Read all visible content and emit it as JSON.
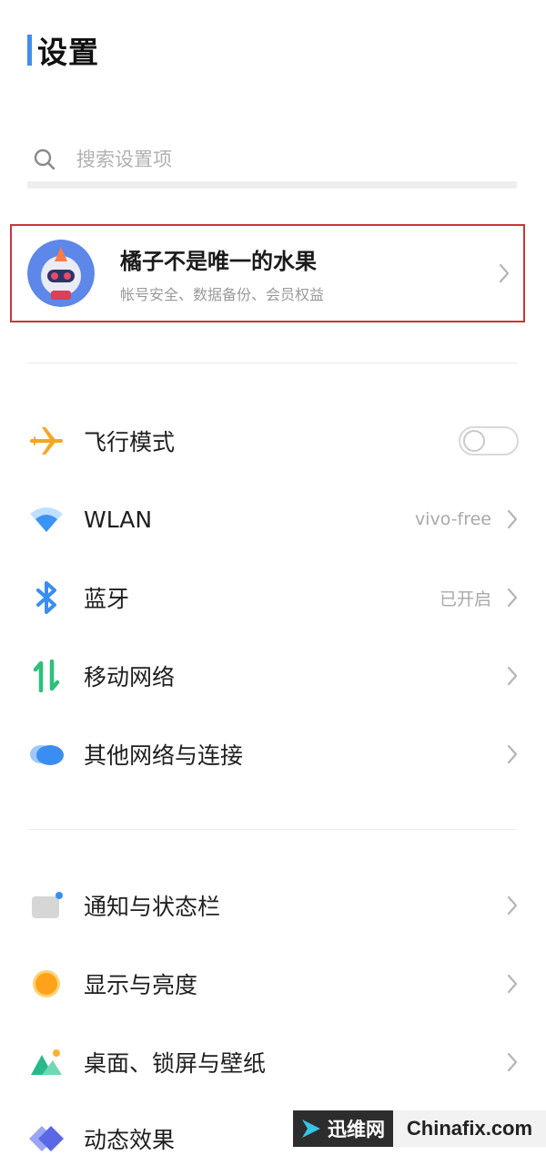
{
  "header": {
    "title": "设置"
  },
  "search": {
    "placeholder": "搜索设置项"
  },
  "account": {
    "name": "橘子不是唯一的水果",
    "subtitle": "帐号安全、数据备份、会员权益"
  },
  "group1": [
    {
      "label": "飞行模式",
      "icon": "airplane-icon",
      "control": "toggle",
      "toggle_on": false
    },
    {
      "label": "WLAN",
      "value": "vivo-free",
      "icon": "wifi-icon"
    },
    {
      "label": "蓝牙",
      "value": "已开启",
      "icon": "bluetooth-icon"
    },
    {
      "label": "移动网络",
      "icon": "mobile-data-icon"
    },
    {
      "label": "其他网络与连接",
      "icon": "cloud-icon"
    }
  ],
  "group2": [
    {
      "label": "通知与状态栏",
      "icon": "notification-icon"
    },
    {
      "label": "显示与亮度",
      "icon": "brightness-icon"
    },
    {
      "label": "桌面、锁屏与壁纸",
      "icon": "wallpaper-icon"
    },
    {
      "label": "动态效果",
      "icon": "motion-effects-icon"
    }
  ],
  "watermark": {
    "cn": "迅维网",
    "en": "Chinafix.com"
  },
  "colors": {
    "accent": "#3d8ef0",
    "highlight_border": "#c6373b",
    "airplane": "#f6a623",
    "wifi": "#3a93f5",
    "mobile_data": "#2ec07a",
    "brightness": "#ffa21a",
    "wallpaper": "#27b98a"
  }
}
